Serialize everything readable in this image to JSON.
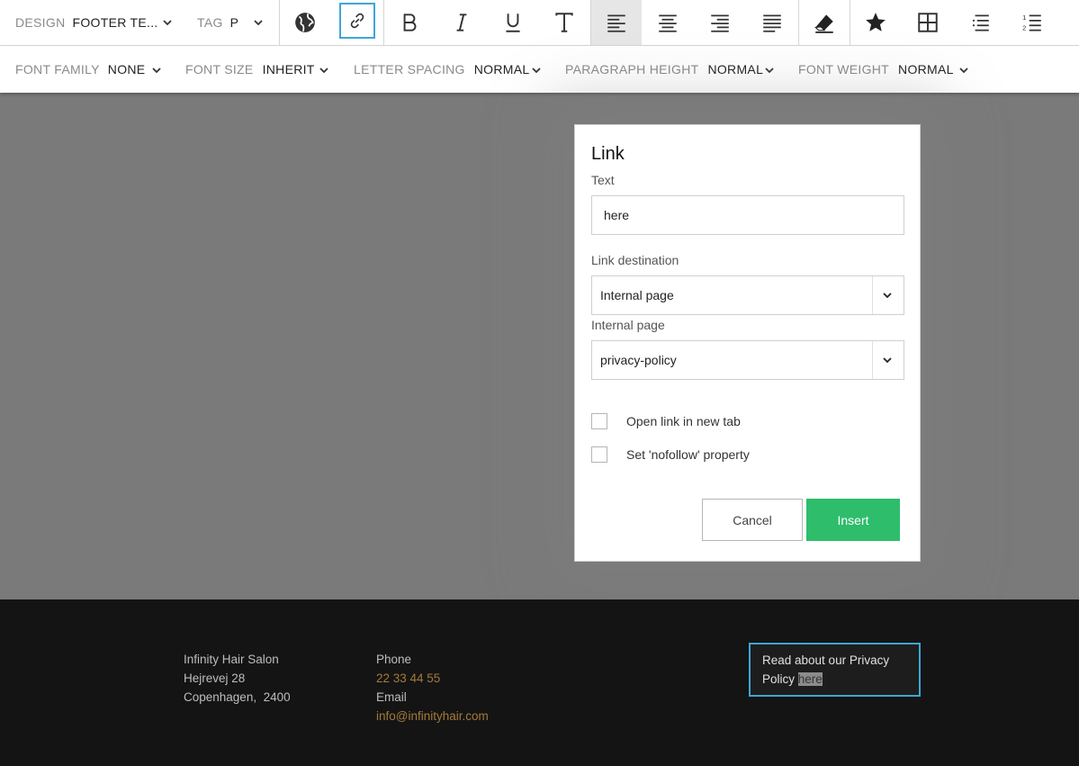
{
  "toolbar": {
    "design_label": "DESIGN",
    "design_value": "FOOTER TE...",
    "tag_label": "TAG",
    "tag_value": "P",
    "icons": [
      "globe-icon",
      "link-icon",
      "bold-icon",
      "italic-icon",
      "underline-icon",
      "text-icon",
      "align-left-icon",
      "align-center-icon",
      "align-right-icon",
      "align-justify-icon",
      "eraser-icon",
      "star-icon",
      "table-icon",
      "bulleted-list-icon",
      "numbered-list-icon"
    ]
  },
  "toolbar2": {
    "font_family_label": "FONT FAMILY",
    "font_family_value": "NONE",
    "font_size_label": "FONT SIZE",
    "font_size_value": "INHERIT",
    "letter_spacing_label": "LETTER SPACING",
    "letter_spacing_value": "NORMAL",
    "paragraph_height_label": "PARAGRAPH HEIGHT",
    "paragraph_height_value": "NORMAL",
    "font_weight_label": "FONT WEIGHT",
    "font_weight_value": "NORMAL"
  },
  "dialog": {
    "title": "Link",
    "text_label": "Text",
    "text_value": "here",
    "destination_label": "Link destination",
    "destination_value": "Internal page",
    "internal_page_label": "Internal page",
    "internal_page_value": "privacy-policy",
    "new_tab_label": "Open link in new tab",
    "nofollow_label": "Set 'nofollow' property",
    "cancel_label": "Cancel",
    "insert_label": "Insert"
  },
  "footer": {
    "salon_name": "Infinity Hair Salon",
    "address_line1": "Hejrevej 28",
    "address_line2": "Copenhagen,  2400",
    "phone_label": "Phone",
    "phone_value": "22 33 44 55",
    "email_label": "Email",
    "email_value": "info@infinityhair.com",
    "privacy_text": "Read about our Privacy Policy ",
    "privacy_link": "here"
  },
  "colors": {
    "accent_blue": "#3ea6d6",
    "insert_green": "#2ebd6b",
    "footer_bg": "#141414",
    "footer_link": "#a47a3a"
  }
}
